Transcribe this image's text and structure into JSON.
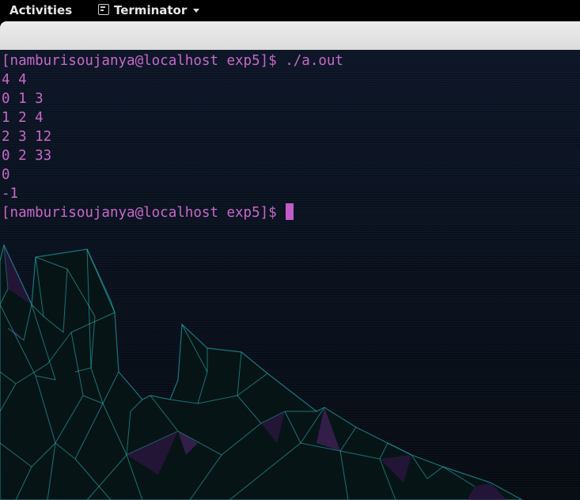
{
  "topbar": {
    "activities_label": "Activities",
    "app_label": "Terminator"
  },
  "terminal": {
    "lines": [
      "[namburisoujanya@localhost exp5]$ ./a.out",
      "4 4",
      "0 1 3",
      "1 2 4",
      "2 3 12",
      "0 2 33",
      "0",
      "-1"
    ],
    "prompt": "[namburisoujanya@localhost exp5]$"
  },
  "colors": {
    "text": "#c868c8",
    "cursor": "#c25bc8",
    "mountain_edges": "#2ec0c0",
    "mountain_accent": "#8a2a9a"
  }
}
